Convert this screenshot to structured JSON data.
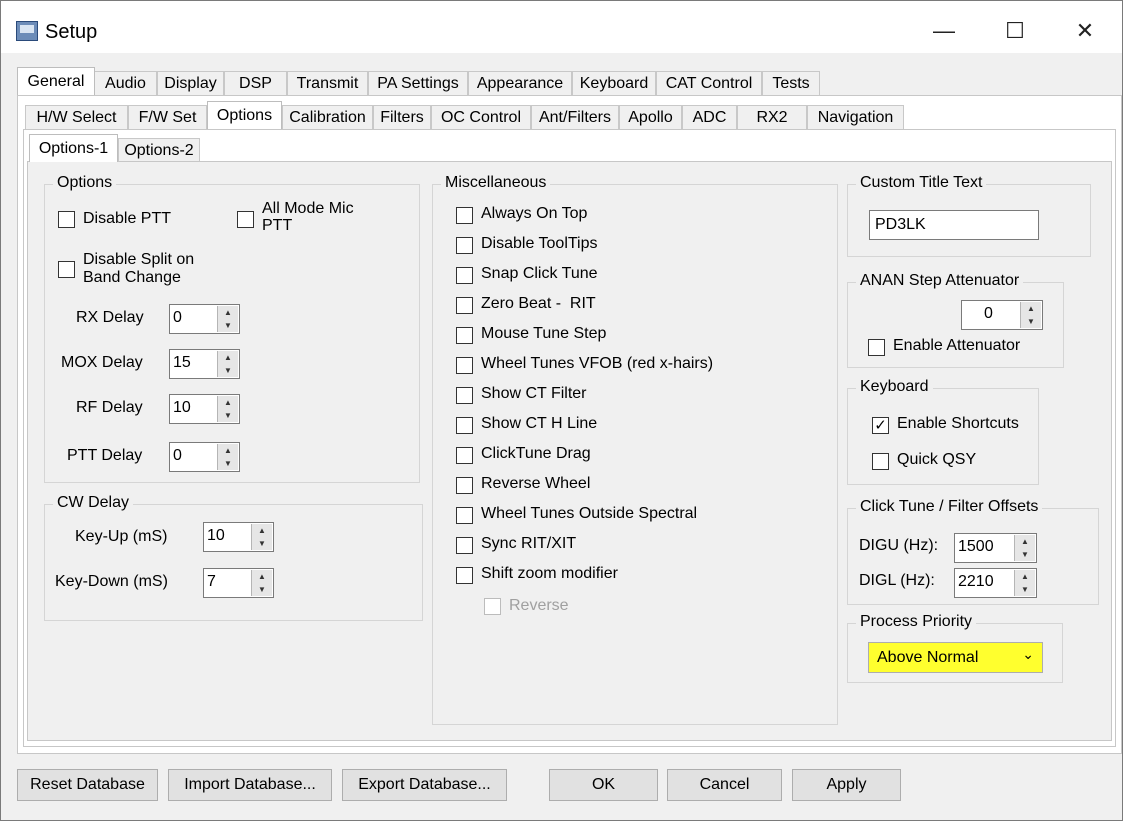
{
  "window": {
    "title": "Setup",
    "minimize": "—",
    "maximize": "☐",
    "close": "✕"
  },
  "tabs_main": [
    "General",
    "Audio",
    "Display",
    "DSP",
    "Transmit",
    "PA Settings",
    "Appearance",
    "Keyboard",
    "CAT Control",
    "Tests"
  ],
  "tabs_general": [
    "H/W Select",
    "F/W Set",
    "Options",
    "Calibration",
    "Filters",
    "OC Control",
    "Ant/Filters",
    "Apollo",
    "ADC",
    "RX2",
    "Navigation"
  ],
  "tabs_options": [
    "Options-1",
    "Options-2"
  ],
  "options_group": {
    "title": "Options",
    "disable_ptt": "Disable PTT",
    "all_mode_mic_1": "All Mode Mic",
    "all_mode_mic_2": "PTT",
    "disable_split_1": "Disable Split on",
    "disable_split_2": "Band Change",
    "rx_delay_label": "RX Delay",
    "rx_delay": "0",
    "mox_delay_label": "MOX Delay",
    "mox_delay": "15",
    "rf_delay_label": "RF Delay",
    "rf_delay": "10",
    "ptt_delay_label": "PTT Delay",
    "ptt_delay": "0"
  },
  "cw_group": {
    "title": "CW Delay",
    "key_up_label": "Key-Up (mS)",
    "key_up": "10",
    "key_down_label": "Key-Down (mS)",
    "key_down": "7"
  },
  "misc_group": {
    "title": "Miscellaneous",
    "items": [
      {
        "label": "Always On Top",
        "checked": false
      },
      {
        "label": "Disable ToolTips",
        "checked": false
      },
      {
        "label": "Snap Click Tune",
        "checked": false
      },
      {
        "label": "Zero Beat -  RIT",
        "checked": false
      },
      {
        "label": "Mouse Tune Step",
        "checked": false
      },
      {
        "label": "Wheel Tunes VFOB (red x-hairs)",
        "checked": false
      },
      {
        "label": "Show CT Filter",
        "checked": false
      },
      {
        "label": "Show CT H Line",
        "checked": false
      },
      {
        "label": "ClickTune Drag",
        "checked": false
      },
      {
        "label": "Reverse Wheel",
        "checked": false
      },
      {
        "label": "Wheel Tunes Outside Spectral",
        "checked": false
      },
      {
        "label": "Sync RIT/XIT",
        "checked": false
      },
      {
        "label": "Shift zoom modifier",
        "checked": false
      }
    ],
    "reverse": "Reverse"
  },
  "custom_title": {
    "title": "Custom Title Text",
    "value": "PD3LK"
  },
  "anan": {
    "title": "ANAN Step Attenuator",
    "value": "0",
    "enable": "Enable Attenuator"
  },
  "keyboard": {
    "title": "Keyboard",
    "enable_shortcuts": "Enable Shortcuts",
    "quick_qsy": "Quick QSY"
  },
  "offsets": {
    "title": "Click Tune / Filter Offsets",
    "digu_label": "DIGU (Hz):",
    "digu": "1500",
    "digl_label": "DIGL (Hz):",
    "digl": "2210"
  },
  "priority": {
    "title": "Process Priority",
    "value": "Above Normal",
    "highlight": "#ffff2e"
  },
  "buttons": {
    "reset": "Reset Database",
    "import": "Import Database...",
    "export": "Export Database...",
    "ok": "OK",
    "cancel": "Cancel",
    "apply": "Apply"
  }
}
